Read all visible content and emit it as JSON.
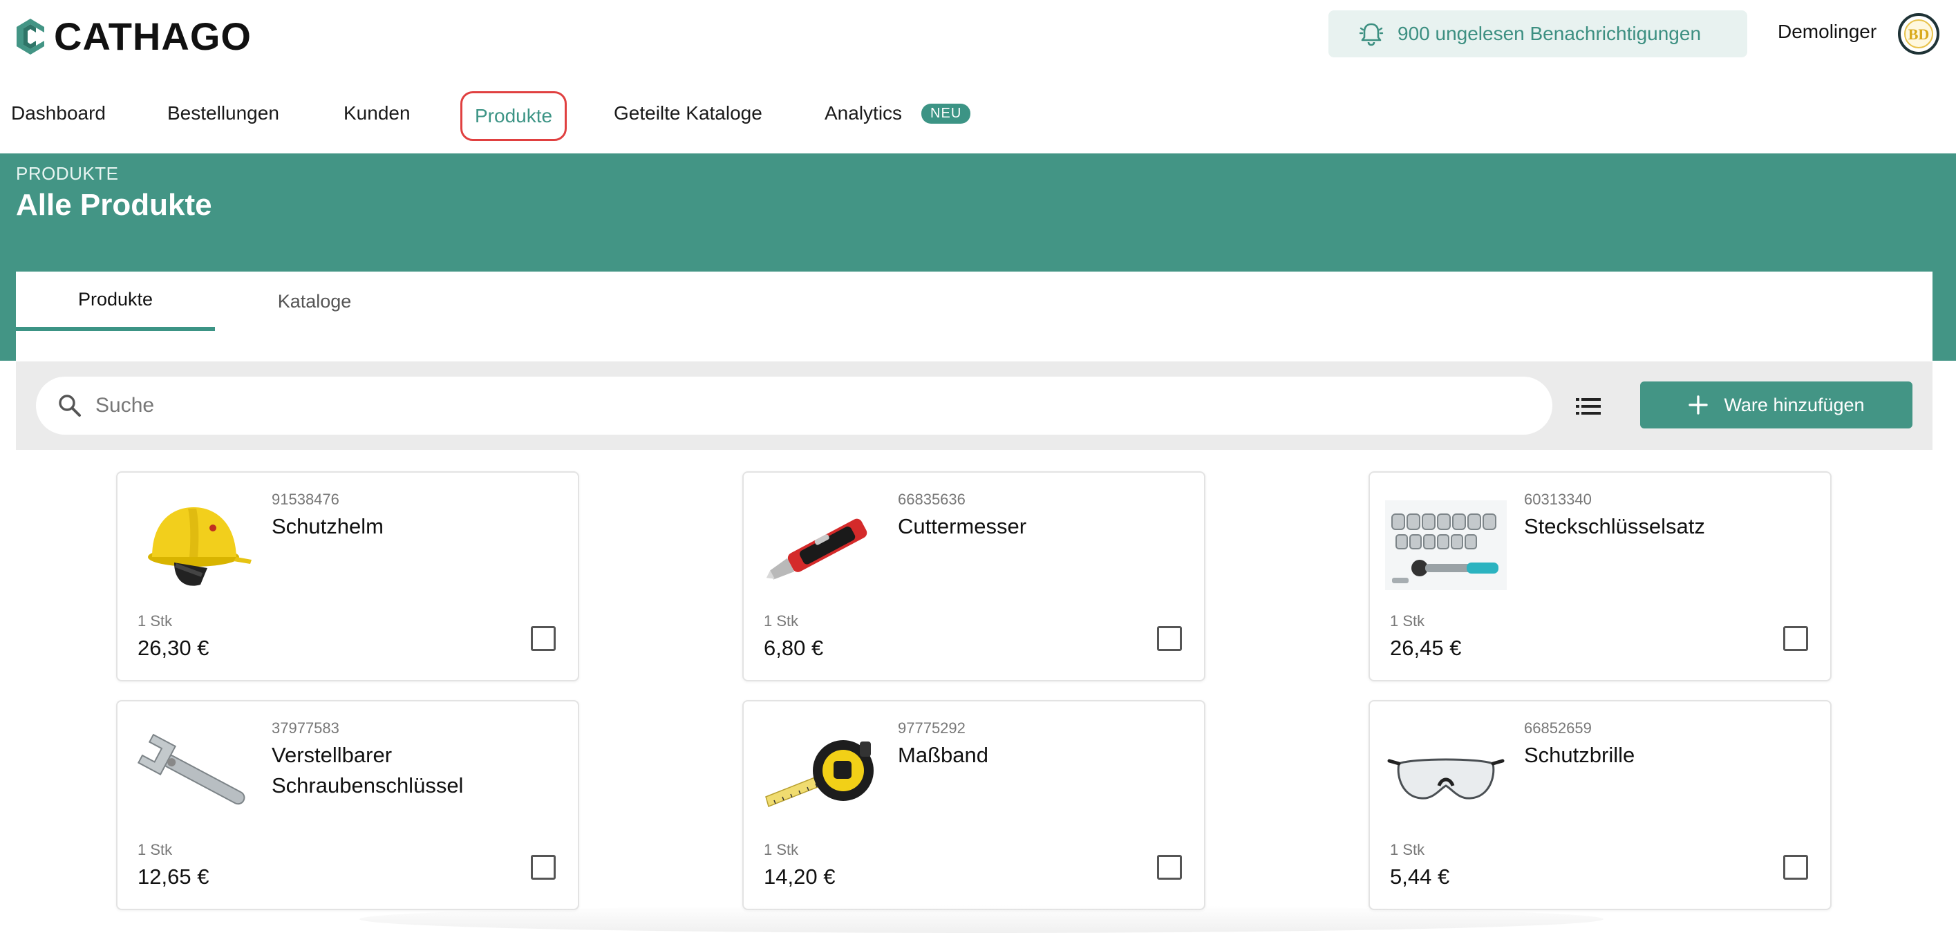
{
  "app": {
    "logo_text": "CATHAGO"
  },
  "header": {
    "notifications_label": "900 ungelesen Benachrichtigungen",
    "user_name": "Demolinger"
  },
  "nav": {
    "items": [
      {
        "label": "Dashboard"
      },
      {
        "label": "Bestellungen"
      },
      {
        "label": "Kunden"
      },
      {
        "label": "Produkte"
      },
      {
        "label": "Geteilte Kataloge"
      },
      {
        "label": "Analytics"
      }
    ],
    "active": "Produkte",
    "analytics_badge": "NEU"
  },
  "page": {
    "breadcrumb": "PRODUKTE",
    "title": "Alle Produkte"
  },
  "tabs": [
    {
      "label": "Produkte"
    },
    {
      "label": "Kataloge"
    }
  ],
  "toolbar": {
    "search_placeholder": "Suche",
    "add_button_label": "Ware hinzufügen"
  },
  "products": [
    {
      "sku": "91538476",
      "name": "Schutzhelm",
      "unit": "1 Stk",
      "price": "26,30 €",
      "icon": "hard-hat-icon"
    },
    {
      "sku": "66835636",
      "name": "Cuttermesser",
      "unit": "1 Stk",
      "price": "6,80 €",
      "icon": "cutter-knife-icon"
    },
    {
      "sku": "60313340",
      "name": "Steckschlüsselsatz",
      "unit": "1 Stk",
      "price": "26,45 €",
      "icon": "socket-set-icon"
    },
    {
      "sku": "37977583",
      "name": "Verstellbarer Schraubenschlüssel",
      "unit": "1 Stk",
      "price": "12,65 €",
      "icon": "adjustable-wrench-icon"
    },
    {
      "sku": "97775292",
      "name": "Maßband",
      "unit": "1 Stk",
      "price": "14,20 €",
      "icon": "tape-measure-icon"
    },
    {
      "sku": "66852659",
      "name": "Schutzbrille",
      "unit": "1 Stk",
      "price": "5,44 €",
      "icon": "safety-glasses-icon"
    }
  ],
  "colors": {
    "brand_teal": "#439585",
    "active_nav_outline": "#e04040",
    "notification_bg": "#e8f2f0"
  }
}
